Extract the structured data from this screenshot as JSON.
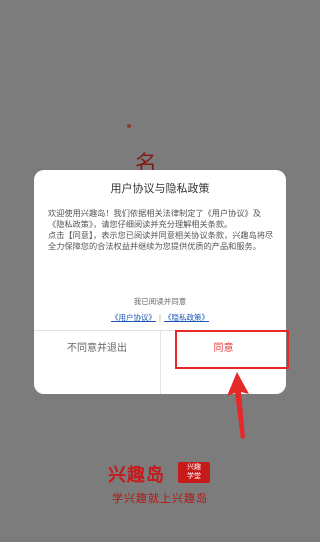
{
  "background": {
    "partial_char": "名"
  },
  "dialog": {
    "title": "用户协议与隐私政策",
    "body_p1": "欢迎使用兴趣岛！我们依据相关法律制定了《用户协议》及《隐私政策》，请您仔细阅读并充分理解相关条款。",
    "body_p2": "点击【同意】，表示您已阅读并同意相关协议条款，兴趣岛将尽全力保障您的合法权益并继续为您提供优质的产品和服务。",
    "agree_notice": "我已阅读并同意",
    "user_agreement_link": "《用户协议》",
    "link_separator": "|",
    "privacy_policy_link": "《隐私政策》",
    "decline_button": "不同意并退出",
    "accept_button": "同意"
  },
  "logo": {
    "name": "兴趣岛",
    "badge_line1": "兴趣",
    "badge_line2": "学堂"
  },
  "slogan": "学兴趣就上兴趣岛",
  "colors": {
    "overlay": "#7c7c7c",
    "accent_red": "#e03a3a",
    "brand_red": "#c71a1a",
    "link_blue": "#1c57b8"
  }
}
